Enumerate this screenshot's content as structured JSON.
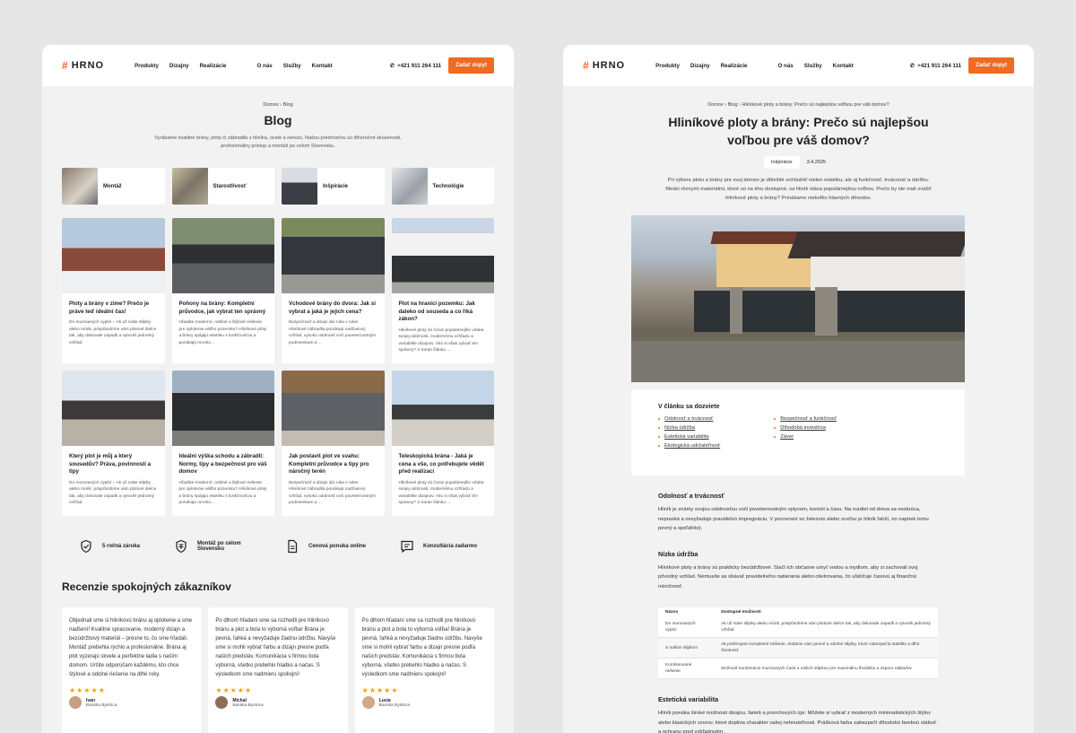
{
  "brand": {
    "name": "HRNO",
    "accent": "#ef6a23"
  },
  "nav": {
    "left": [
      "Produkty",
      "Dizajny",
      "Realizácie"
    ],
    "right": [
      "O nás",
      "Služby",
      "Kontakt"
    ],
    "phone": "+421 911 264 111",
    "cta": "Zadať dopyt"
  },
  "blog": {
    "breadcrumb": [
      "Domov",
      "Blog"
    ],
    "title": "Blog",
    "subtitle": "Vyrábame kvalitné brány, ploty či zábradlia z hliníka, ocele a nerezu. Našou prednosťou sú dlhoročné skúsenosti, profesionálny prístup a montáž po celom Slovensku.",
    "categories": [
      "Montáž",
      "Starostlivosť",
      "Inšpirácie",
      "Technológie"
    ],
    "posts": [
      {
        "title": "Ploty a brány v zime? Prečo je práve teď ideální čas!",
        "desc": "Do murovaných výplní – Ak už máte stĺpiky alebo múrik, prispôsobíme vám plotové dielce tak, aby dokonale zapadli a vytvorili jednotný vzhľad."
      },
      {
        "title": "Pohony na brány: Kompletní průvodce, jak vybrat ten správný",
        "desc": "Hľadáte moderné, odolné a štýlové riešenie pre oplotenie vášho pozemku? Hliníkové ploty a brány spájajú estetiku s funkčnosťou a ponúkajú mnoho..."
      },
      {
        "title": "Vchodové brány do dvora: Jak si vybrat a jaká je jejich cena?",
        "desc": "Bezpečnosť a dizajn idú ruka v ruke! Hliníkové zábradlia ponúkajú nadčasový vzhľad, vysokú odolnosť voči poveternostným podmienkam a ..."
      },
      {
        "title": "Plot na hranici pozemku: Jak daleko od souseda a co říká zákon?",
        "desc": "Hliníkové ploty sú čoraz populárnejšie vďaka svojej odolnosti, modernému vzhľadu a variabilite dizajnov. Ako si však vybrať ten správny? V tomto článku ..."
      },
      {
        "title": "Který plot je můj a který sousedův? Práva, povinnosti a tipy",
        "desc": "Do murovaných výplní – Ak už máte stĺpiky alebo múrik, prispôsobíme vám plotové dielce tak, aby dokonale zapadli a vytvorili jednotný vzhľad."
      },
      {
        "title": "Ideální výška schodu a zábradlí: Normy, tipy a bezpečnost pro váš domov",
        "desc": "Hľadáte moderné, odolné a štýlové riešenie pre oplotenie vášho pozemku? Hliníkové ploty a brány spájajú estetiku s funkčnosťou a ponúkajú mnoho..."
      },
      {
        "title": "Jak postavit plot ve svahu: Kompletní průvodce a tipy pro náročný terén",
        "desc": "Bezpečnosť a dizajn idú ruka v ruke! Hliníkové zábradlia ponúkajú nadčasový vzhľad, vysokú odolnosť voči poveternostným podmienkam a ..."
      },
      {
        "title": "Teleskopická brána - Jaká je cena a vše, co potřebujete vědět před realizací",
        "desc": "Hliníkové ploty sú čoraz populárnejšie vďaka svojej odolnosti, modernému vzhľadu a variabilite dizajnov. Ako si však vybrať ten správny? V tomto článku ..."
      }
    ],
    "features": [
      "5 ročná záruka",
      "Montáž po celom Slovensku",
      "Cenová ponuka online",
      "Konzultácia zadarmo"
    ],
    "reviews_title": "Recenzie spokojných zákazníkov",
    "reviews": [
      {
        "text": "Objednali sme si hliníkovú bránu aj oplotenie a sme nadšení! Kvalitné spracovanie, moderný dizajn a bezúdržbový materiál – presne to, čo sme hľadali. Montáž prebehla rýchlo a profesionálne. Brána aj plot vyzerajú skvele a perfektne ladia s naším domom. Určite odporúčam každému, kto chce štýlové a odolné riešenie na dlhé roky.",
        "name": "Ivan",
        "city": "Banska Bystrica"
      },
      {
        "text": "Po dlhom hľadaní sme sa rozhodli pre hliníkovú bránu a plot a bola to výborná voľba! Brána je pevná, ľahká a nevyžaduje žiadnu údržbu. Navyše sme si mohli vybrať farbu a dizajn presne podľa našich predstáv. Komunikácia s firmou bola výborná, všetko prebehlo hladko a načas. S výsledkom sme nadmieru spokojní!",
        "name": "Michal",
        "city": "Banska Bystrica"
      },
      {
        "text": "Po dlhom hľadaní sme sa rozhodli pre hliníkovú bránu a plot a bola to výborná voľba! Brána je pevná, ľahká a nevyžaduje žiadnu údržbu. Navyše sme si mohli vybrať farbu a dizajn presne podľa našich predstáv. Komunikácia s firmou bola výborná, všetko prebehlo hladko a načas. S výsledkom sme nadmieru spokojní!",
        "name": "Lucia",
        "city": "Banska Bystrica"
      }
    ],
    "stars": "★★★★★"
  },
  "article": {
    "breadcrumb": [
      "Domov",
      "Blog",
      "Hliníkové ploty a brány: Prečo sú najlepšou voľbou pre váš domov?"
    ],
    "title_line1": "Hliníkové ploty a brány: Prečo sú najlepšou",
    "title_line2": "voľbou pre váš domov?",
    "category": "Inšpirácie",
    "date": "3.4.2025",
    "lead": "Pri výbere plotu a brány pre svoj domov je dôležité zohľadniť nielen estetiku, ale aj funkčnosť, trvácnosť a údržbu. Medzi rôznymi materiálmi, ktoré sú na trhu dostupné, sa hliník stáva populárnejšou voľbou. Prečo by ste mali zvážiť hliníkové ploty a brány? Prinášame niekoľko hlavných dôvodov.",
    "toc_title": "V článku sa dozviete",
    "toc_left": [
      "Odolnosť a trvácnosť",
      "Nízka údržba",
      "Estetická variabilita",
      "Ekologická udržateľnosť"
    ],
    "toc_right": [
      "Bezpečnosť a funkčnosť",
      "Dlhodobá investícia",
      "Záver"
    ],
    "sections": [
      {
        "title": "Odolnosť a trvácnosť",
        "text": "Hliník je známy svojou odolnosťou voči poveternostným vplyvom, korózii a času. Na rozdiel od dreva sa neskrúca, nepraská a nevyžaduje pravidelnú impregnáciu. V porovnaní so železom alebo oceľou je hliník ľahší, no napriek tomu pevný a spoľahlivý."
      },
      {
        "title": "Nízka údržba",
        "text": "Hliníkové ploty a brány sú prakticky bezúdržbové. Stačí ich občasne umyť vodou a mydlom, aby si zachovali svoj pôvodný vzhľad. Nemusíte sa obávať pravidelného natierania alebo ošetrovania, čo uľahčuje časovú aj finančnú náročnosť."
      }
    ],
    "table": {
      "headers": [
        "Názov",
        "Dostupné možnosti"
      ],
      "rows": [
        [
          "Do murovaných výplní",
          "Ak už máte stĺpiky alebo múrik, prispôsobíme vám plotové dielce tak, aby dokonale zapadli a vytvorili jednotný vzhľad"
        ],
        [
          "S našimi stĺpikmi",
          "Ak preferujete kompletné riešenie, dodáme vám pevné a odolné stĺpiky, ktoré zabezpečia stabilitu a dlhú životnosť"
        ],
        [
          "Kombinované riešenie",
          "Možnosť kombinácie murovaných častí a našich stĺpikov pre maximálnu flexibilitu a úsporu nákladov"
        ]
      ]
    },
    "section3": {
      "title": "Estetická variabilita",
      "text": "Hliník ponúka široké možnosti dizajnu, farieb a povrchových úpr. Môžete si vybrať z moderných minimalistických štýlov alebo klasických vzorov, ktoré doplnia charakter vašej nehnuteľnosti. Prášková farba zabezpečí dlhodobú farebnú stálosť a ochranu pred vybľadnutím."
    }
  }
}
